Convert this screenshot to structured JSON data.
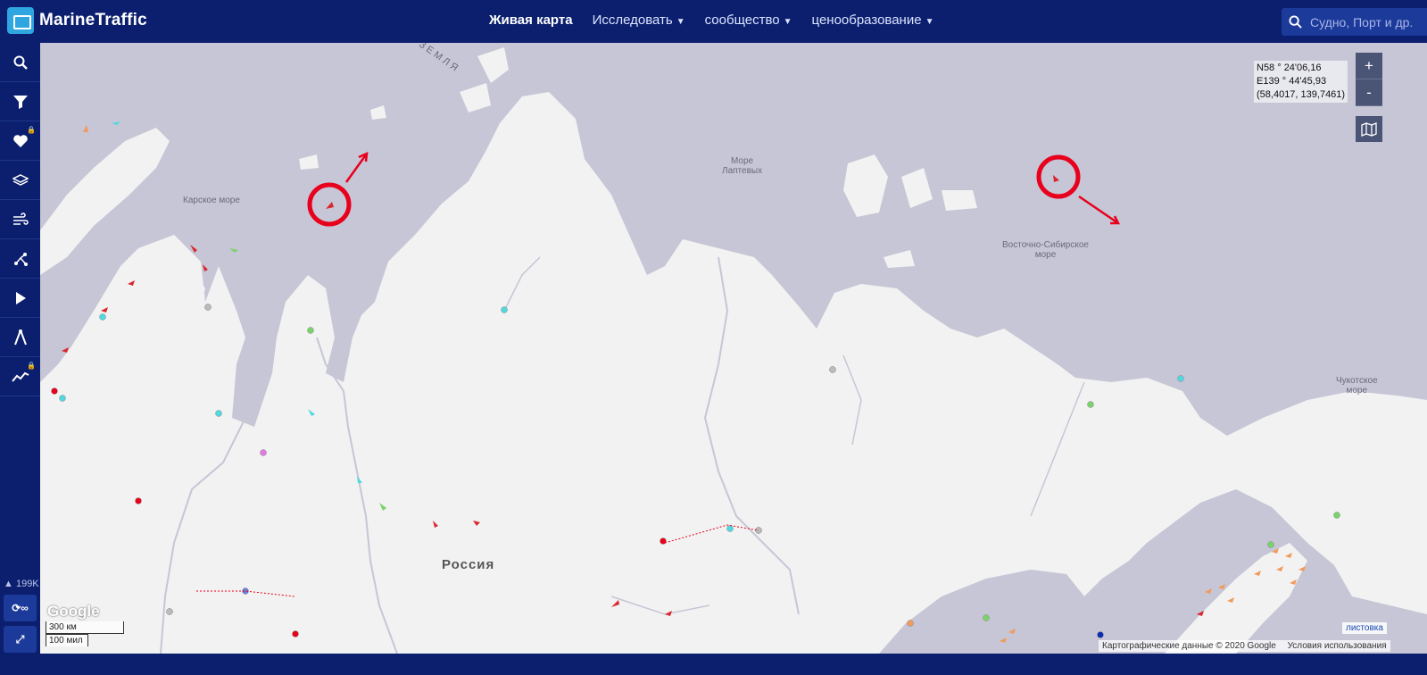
{
  "header": {
    "brand": "MarineTraffic",
    "nav": [
      {
        "label": "Живая карта",
        "dropdown": false
      },
      {
        "label": "Исследовать",
        "dropdown": true
      },
      {
        "label": "сообщество",
        "dropdown": true
      },
      {
        "label": "ценообразование",
        "dropdown": true
      }
    ],
    "search_placeholder": "Судно, Порт и др."
  },
  "sidebar": {
    "icons": [
      "search-icon",
      "filter-icon",
      "heart-icon",
      "layers-icon",
      "wind-icon",
      "route-icon",
      "play-icon",
      "measure-icon",
      "analytics-icon"
    ],
    "vessel_count": "199K",
    "infinity_label": "∞"
  },
  "map": {
    "labels": {
      "kara_sea": "Карское море",
      "laptev_sea": "Море\nЛаптевых",
      "east_siberian_sea": "Восточно-Сибирское\nморе",
      "chukchi_sea": "Чукотское\nморе",
      "russia": "Россия",
      "novaya_zemlya": "Я ЗЕМЛЯ"
    },
    "coords": {
      "lat": "N58 ° 24'06,16",
      "lon": "E139 ° 44'45,93",
      "decimal": "(58,4017, 139,7461)"
    },
    "zoom_in": "+",
    "zoom_out": "-",
    "google": "Google",
    "scale_km": "300 км",
    "scale_mi": "100 мил",
    "attribution": "Картографические данные © 2020 Google",
    "terms": "Условия использования",
    "listovka": "листовка",
    "colors": {
      "water": "#c6c6d6",
      "land": "#f2f2f2",
      "marker_red": "#e8001c",
      "cargo_green": "#7ad36a",
      "tanker_red": "#d9272d",
      "passenger_cyan": "#4fd8e0",
      "fishing_orange": "#f29a5a"
    }
  }
}
